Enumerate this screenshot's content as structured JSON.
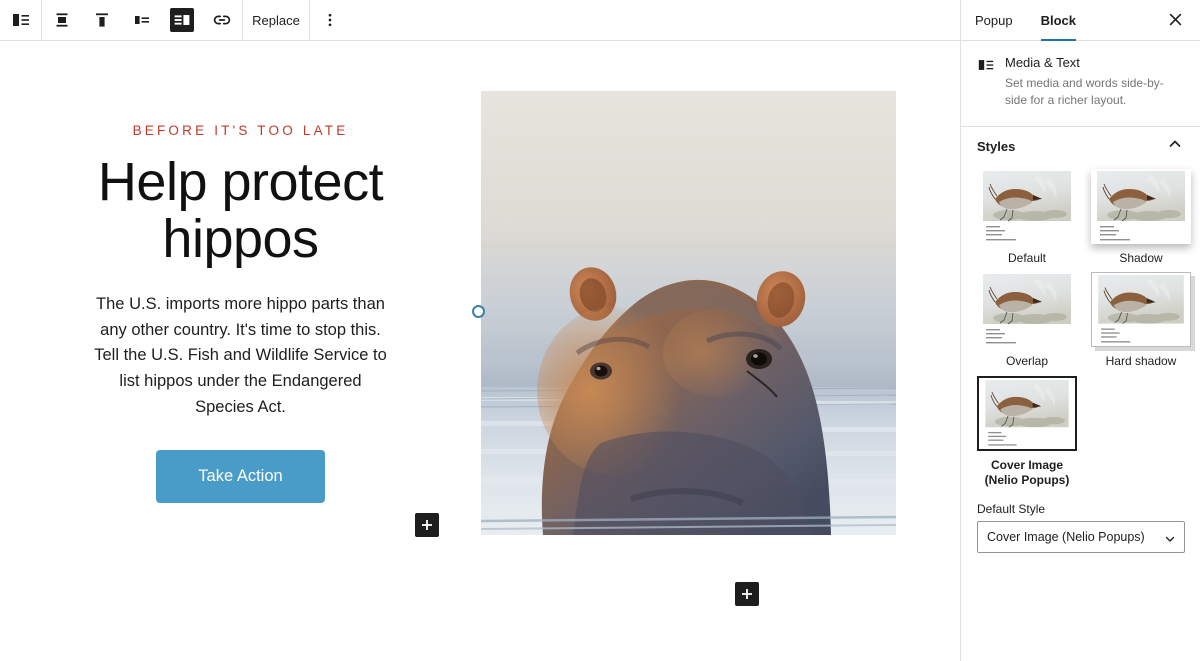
{
  "toolbar": {
    "buttons": [
      {
        "name": "block-type-media-text",
        "icon": "media-text-block-icon",
        "label": ""
      },
      {
        "name": "align-vertical-center",
        "icon": "vertical-align-center-icon",
        "label": ""
      },
      {
        "name": "align-vertical-top",
        "icon": "vertical-align-top-icon",
        "label": ""
      },
      {
        "name": "media-on-left",
        "icon": "media-left-icon",
        "label": ""
      },
      {
        "name": "media-on-right",
        "icon": "media-right-icon",
        "label": ""
      },
      {
        "name": "link",
        "icon": "link-icon",
        "label": ""
      }
    ],
    "replace_label": "Replace",
    "more_options_label": "Options"
  },
  "content": {
    "eyebrow": "BEFORE IT'S TOO LATE",
    "headline": "Help protect hippos",
    "body": "The U.S. imports more hippo parts than any other country. It's time to stop this. Tell the U.S. Fish and Wildlife Service to list hippos under the Endangered Species Act.",
    "cta_label": "Take Action",
    "cta_color": "#4a9cc8",
    "eyebrow_color": "#c0392b",
    "image_alt": "hippo"
  },
  "inserters": {
    "inner_label": "+",
    "outer_label": "+"
  },
  "sidebar": {
    "tabs": [
      {
        "label": "Popup",
        "active": false
      },
      {
        "label": "Block",
        "active": true
      }
    ],
    "close_label": "Close settings",
    "accent_color": "#2271b1",
    "block": {
      "title": "Media & Text",
      "description": "Set media and words side-by-side for a richer layout.",
      "icon": "media-text-block-icon"
    },
    "styles_section": {
      "title": "Styles",
      "expanded": true,
      "items": [
        {
          "label": "Default",
          "selected": false,
          "variant": "plain"
        },
        {
          "label": "Shadow",
          "selected": false,
          "variant": "shadow"
        },
        {
          "label": "Overlap",
          "selected": false,
          "variant": "plain"
        },
        {
          "label": "Hard shadow",
          "selected": false,
          "variant": "hardshadow"
        },
        {
          "label": "Cover Image (Nelio Popups)",
          "selected": true,
          "variant": "selected"
        }
      ],
      "preview_caption_lines": [
        "The wren",
        "Earns his living",
        "Noiselessly.",
        "— Kobayashi Issa (1763-1828)"
      ]
    },
    "default_style": {
      "label": "Default Style",
      "value": "Cover Image (Nelio Popups)",
      "options": [
        "Default",
        "Shadow",
        "Overlap",
        "Hard shadow",
        "Cover Image (Nelio Popups)"
      ]
    }
  }
}
